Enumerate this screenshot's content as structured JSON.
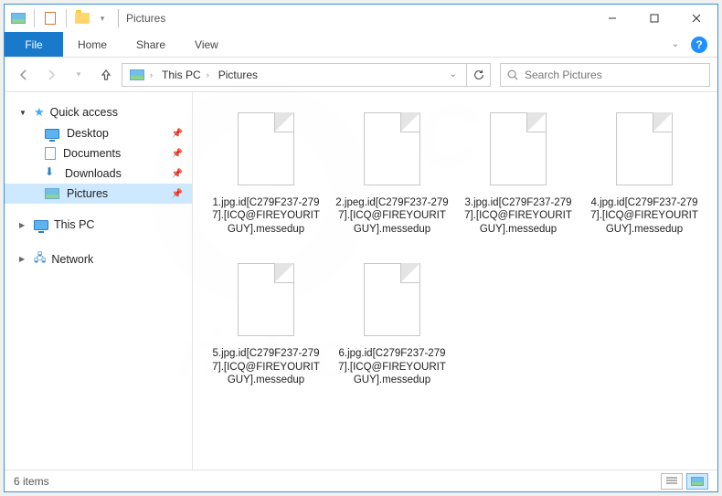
{
  "window": {
    "title": "Pictures"
  },
  "menubar": {
    "file": "File",
    "items": [
      "Home",
      "Share",
      "View"
    ]
  },
  "breadcrumb": {
    "segments": [
      "This PC",
      "Pictures"
    ],
    "dropdown_hint": "v"
  },
  "search": {
    "placeholder": "Search Pictures"
  },
  "nav": {
    "quick_access": {
      "label": "Quick access",
      "items": [
        {
          "label": "Desktop",
          "icon": "desktop"
        },
        {
          "label": "Documents",
          "icon": "document"
        },
        {
          "label": "Downloads",
          "icon": "download"
        },
        {
          "label": "Pictures",
          "icon": "picture",
          "selected": true
        }
      ]
    },
    "this_pc": {
      "label": "This PC"
    },
    "network": {
      "label": "Network"
    }
  },
  "files": [
    {
      "name": "1.jpg.id[C279F237-2797].[ICQ@FIREYOURITGUY].messedup"
    },
    {
      "name": "2.jpeg.id[C279F237-2797].[ICQ@FIREYOURITGUY].messedup"
    },
    {
      "name": "3.jpg.id[C279F237-2797].[ICQ@FIREYOURITGUY].messedup"
    },
    {
      "name": "4.jpg.id[C279F237-2797].[ICQ@FIREYOURITGUY].messedup"
    },
    {
      "name": "5.jpg.id[C279F237-2797].[ICQ@FIREYOURITGUY].messedup"
    },
    {
      "name": "6.jpg.id[C279F237-2797].[ICQ@FIREYOURITGUY].messedup"
    }
  ],
  "status": {
    "count_label": "6 items"
  }
}
